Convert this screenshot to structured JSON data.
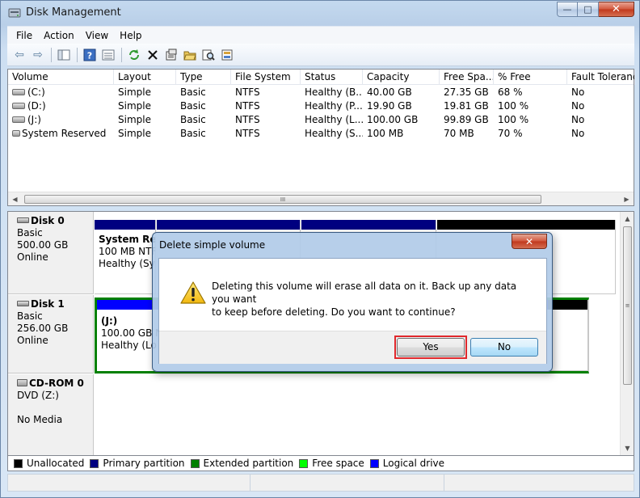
{
  "window": {
    "title": "Disk Management",
    "min": "—",
    "max": "□",
    "close": "✕"
  },
  "menu": [
    "File",
    "Action",
    "View",
    "Help"
  ],
  "toolbar": {
    "back": "⇦",
    "forward": "⇨",
    "scrollbar_glyph": "III"
  },
  "volumes": {
    "columns": [
      "Volume",
      "Layout",
      "Type",
      "File System",
      "Status",
      "Capacity",
      "Free Spa...",
      "% Free",
      "Fault Toleranc"
    ],
    "rows": [
      [
        "(C:)",
        "Simple",
        "Basic",
        "NTFS",
        "Healthy (B...",
        "40.00 GB",
        "27.35 GB",
        "68 %",
        "No"
      ],
      [
        "(D:)",
        "Simple",
        "Basic",
        "NTFS",
        "Healthy (P...",
        "19.90 GB",
        "19.81 GB",
        "100 %",
        "No"
      ],
      [
        "(J:)",
        "Simple",
        "Basic",
        "NTFS",
        "Healthy (L...",
        "100.00 GB",
        "99.89 GB",
        "100 %",
        "No"
      ],
      [
        "System Reserved",
        "Simple",
        "Basic",
        "NTFS",
        "Healthy (S...",
        "100 MB",
        "70 MB",
        "70 %",
        "No"
      ]
    ]
  },
  "disks": [
    {
      "name": "Disk 0",
      "type": "Basic",
      "size": "500.00 GB",
      "state": "Online",
      "partitions": [
        {
          "label": "System Res",
          "size": "100 MB NTF",
          "status": "Healthy (Sys"
        }
      ]
    },
    {
      "name": "Disk 1",
      "type": "Basic",
      "size": "256.00 GB",
      "state": "Online",
      "partitions": [
        {
          "label": "(J:)",
          "size": "100.00 GB N",
          "status": "Healthy (Lo"
        }
      ]
    },
    {
      "name": "CD-ROM 0",
      "type": "DVD (Z:)",
      "size": "",
      "state": "No Media",
      "partitions": []
    }
  ],
  "legend": [
    {
      "label": "Unallocated",
      "color": "#000000"
    },
    {
      "label": "Primary partition",
      "color": "#000080"
    },
    {
      "label": "Extended partition",
      "color": "#008000"
    },
    {
      "label": "Free space",
      "color": "#00ff00"
    },
    {
      "label": "Logical drive",
      "color": "#0000ff"
    }
  ],
  "dialog": {
    "title": "Delete simple volume",
    "close": "✕",
    "message_line1": "Deleting this volume will erase all data on it. Back up any data you want",
    "message_line2": "to keep before deleting. Do you want to continue?",
    "yes": "Yes",
    "no": "No"
  }
}
